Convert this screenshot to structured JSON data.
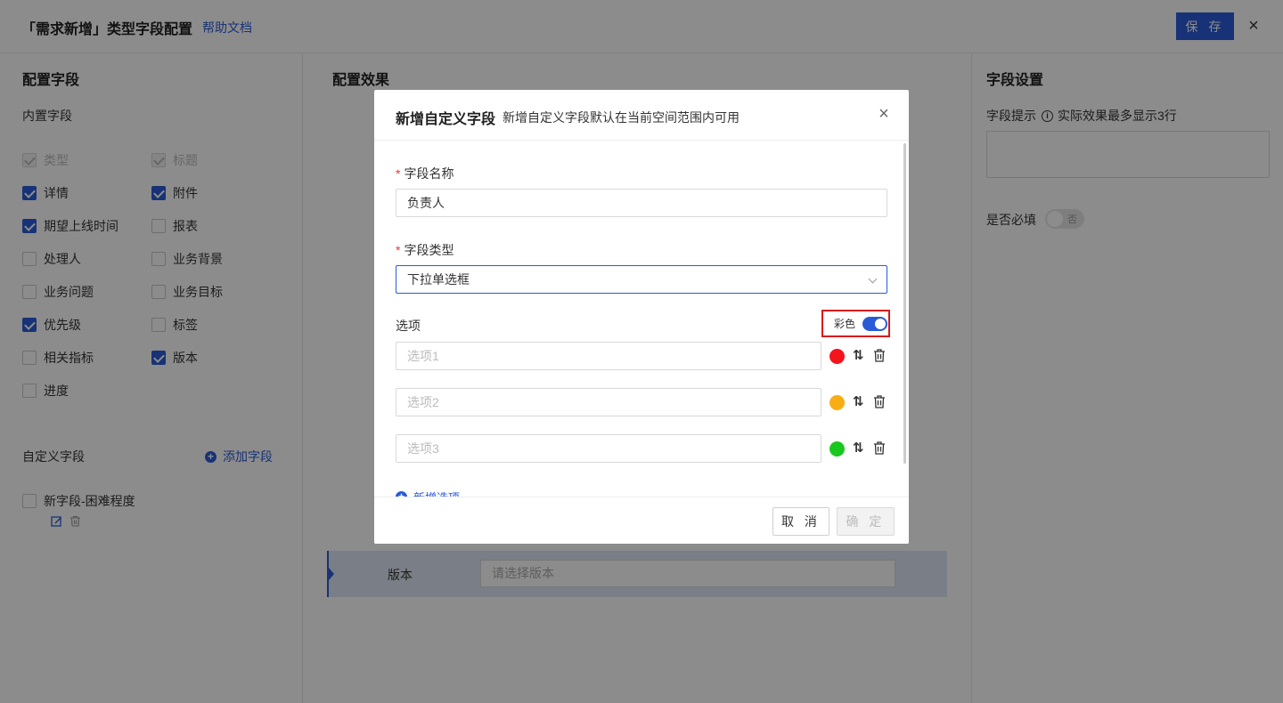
{
  "header": {
    "title": "「需求新增」类型字段配置",
    "help_link": "帮助文档",
    "save_label": "保 存",
    "close_glyph": "×"
  },
  "left_panel": {
    "title": "配置字段",
    "builtin_label": "内置字段",
    "builtin_fields": [
      {
        "label": "类型",
        "state": "disabled"
      },
      {
        "label": "标题",
        "state": "disabled"
      },
      {
        "label": "详情",
        "state": "checked"
      },
      {
        "label": "附件",
        "state": "checked"
      },
      {
        "label": "期望上线时间",
        "state": "checked"
      },
      {
        "label": "报表",
        "state": "unchecked"
      },
      {
        "label": "处理人",
        "state": "unchecked"
      },
      {
        "label": "业务背景",
        "state": "unchecked"
      },
      {
        "label": "业务问题",
        "state": "unchecked"
      },
      {
        "label": "业务目标",
        "state": "unchecked"
      },
      {
        "label": "优先级",
        "state": "checked"
      },
      {
        "label": "标签",
        "state": "unchecked"
      },
      {
        "label": "相关指标",
        "state": "unchecked"
      },
      {
        "label": "版本",
        "state": "checked"
      },
      {
        "label": "进度",
        "state": "unchecked"
      }
    ],
    "custom_label": "自定义字段",
    "add_field_label": "添加字段",
    "custom_fields": [
      {
        "label": "新字段-困难程度",
        "state": "unchecked"
      }
    ]
  },
  "mid_panel": {
    "title": "配置效果",
    "version_label": "版本",
    "version_placeholder": "请选择版本"
  },
  "right_panel": {
    "title": "字段设置",
    "tip_label": "字段提示",
    "tip_info": "实际效果最多显示3行",
    "required_label": "是否必填",
    "required_switch_text": "否"
  },
  "modal": {
    "title": "新增自定义字段",
    "subtitle": "新增自定义字段默认在当前空间范围内可用",
    "close_glyph": "×",
    "name_label": "字段名称",
    "name_value": "负责人",
    "type_label": "字段类型",
    "type_value": "下拉单选框",
    "options_label": "选项",
    "color_label": "彩色",
    "color_enabled": true,
    "options": [
      {
        "placeholder": "选项1",
        "color": "#f5141c"
      },
      {
        "placeholder": "选项2",
        "color": "#f9ad14"
      },
      {
        "placeholder": "选项3",
        "color": "#19c81e"
      }
    ],
    "sort_glyph": "⇅",
    "add_option_label": "新增选项",
    "cancel_label": "取 消",
    "ok_label": "确 定"
  },
  "colors": {
    "accent": "#2a5bd7",
    "highlight_border": "#d9161c"
  }
}
